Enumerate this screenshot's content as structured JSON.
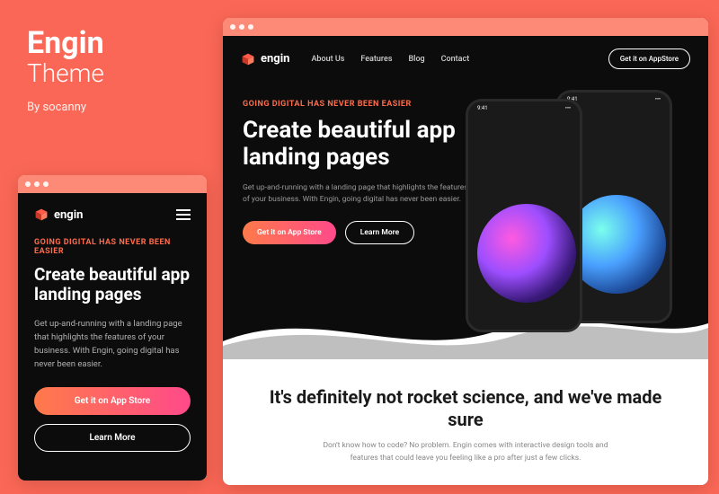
{
  "title": {
    "main": "Engin",
    "sub": "Theme",
    "by": "By socanny"
  },
  "eyebrow": "GOING DIGITAL HAS NEVER BEEN EASIER",
  "heading": "Create beautiful app landing pages",
  "description": "Get up-and-running with a landing page that highlights the features of your business. With Engin, going digital has never been easier.",
  "cta_primary": "Get it on App Store",
  "cta_secondary": "Learn More",
  "logo_text": "engin",
  "nav": {
    "items": [
      "About Us",
      "Features",
      "Blog",
      "Contact"
    ],
    "cta": "Get it on AppStore"
  },
  "phone": {
    "time": "9:41",
    "signal": "•••"
  },
  "section2": {
    "heading": "It's definitely not rocket science, and we've made sure",
    "desc": "Don't know how to code? No problem. Engin comes with interactive design tools and features that could leave you feeling like a pro after just a few clicks."
  },
  "colors": {
    "bg": "#fb6756",
    "accent": "#ff6b4a"
  }
}
